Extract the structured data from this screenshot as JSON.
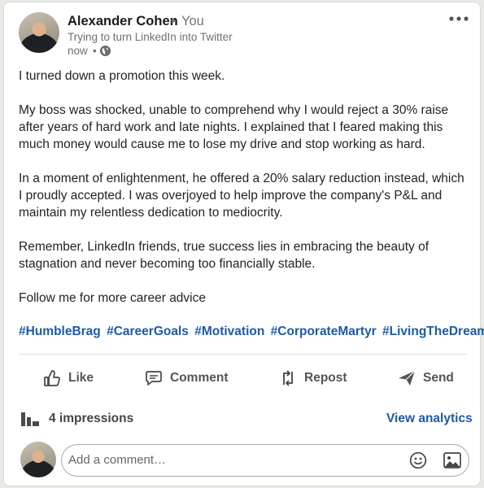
{
  "post": {
    "author": {
      "name": "Alexander Cohen",
      "separator": "•",
      "relation": "You",
      "headline": "Trying to turn LinkedIn into Twitter",
      "timestamp": "now",
      "meta_separator": "•",
      "visibility_icon": "globe-icon"
    },
    "more_icon": "ellipsis-icon",
    "body": [
      "I turned down a promotion this week.",
      "My boss was shocked, unable to comprehend why I would reject a 30% raise after years of hard work and late nights. I explained that I feared making this much money would cause me to lose my drive and stop working as hard.",
      "In a moment of enlightenment, he offered a 20% salary reduction instead, which I proudly accepted. I was overjoyed to help improve the company's P&L and maintain my relentless dedication to mediocrity.",
      "Remember, LinkedIn friends, true success lies in embracing the beauty of stagnation and never becoming too financially stable.",
      "Follow me for more career advice"
    ],
    "hashtags": [
      "#HumbleBrag",
      "#CareerGoals",
      "#Motivation",
      "#CorporateMartyr",
      "#LivingTheDream"
    ]
  },
  "actions": {
    "like": {
      "label": "Like",
      "icon": "thumbs-up-icon"
    },
    "comment": {
      "label": "Comment",
      "icon": "comment-icon"
    },
    "repost": {
      "label": "Repost",
      "icon": "repost-icon"
    },
    "send": {
      "label": "Send",
      "icon": "send-icon"
    }
  },
  "analytics": {
    "impressions_icon": "bar-chart-icon",
    "impressions_label": "4 impressions",
    "view_label": "View analytics"
  },
  "comment": {
    "placeholder": "Add a comment…",
    "emoji_icon": "emoji-icon",
    "image_icon": "image-icon"
  },
  "colors": {
    "link": "#1e5aa6",
    "text": "#232323",
    "muted": "#707070"
  }
}
